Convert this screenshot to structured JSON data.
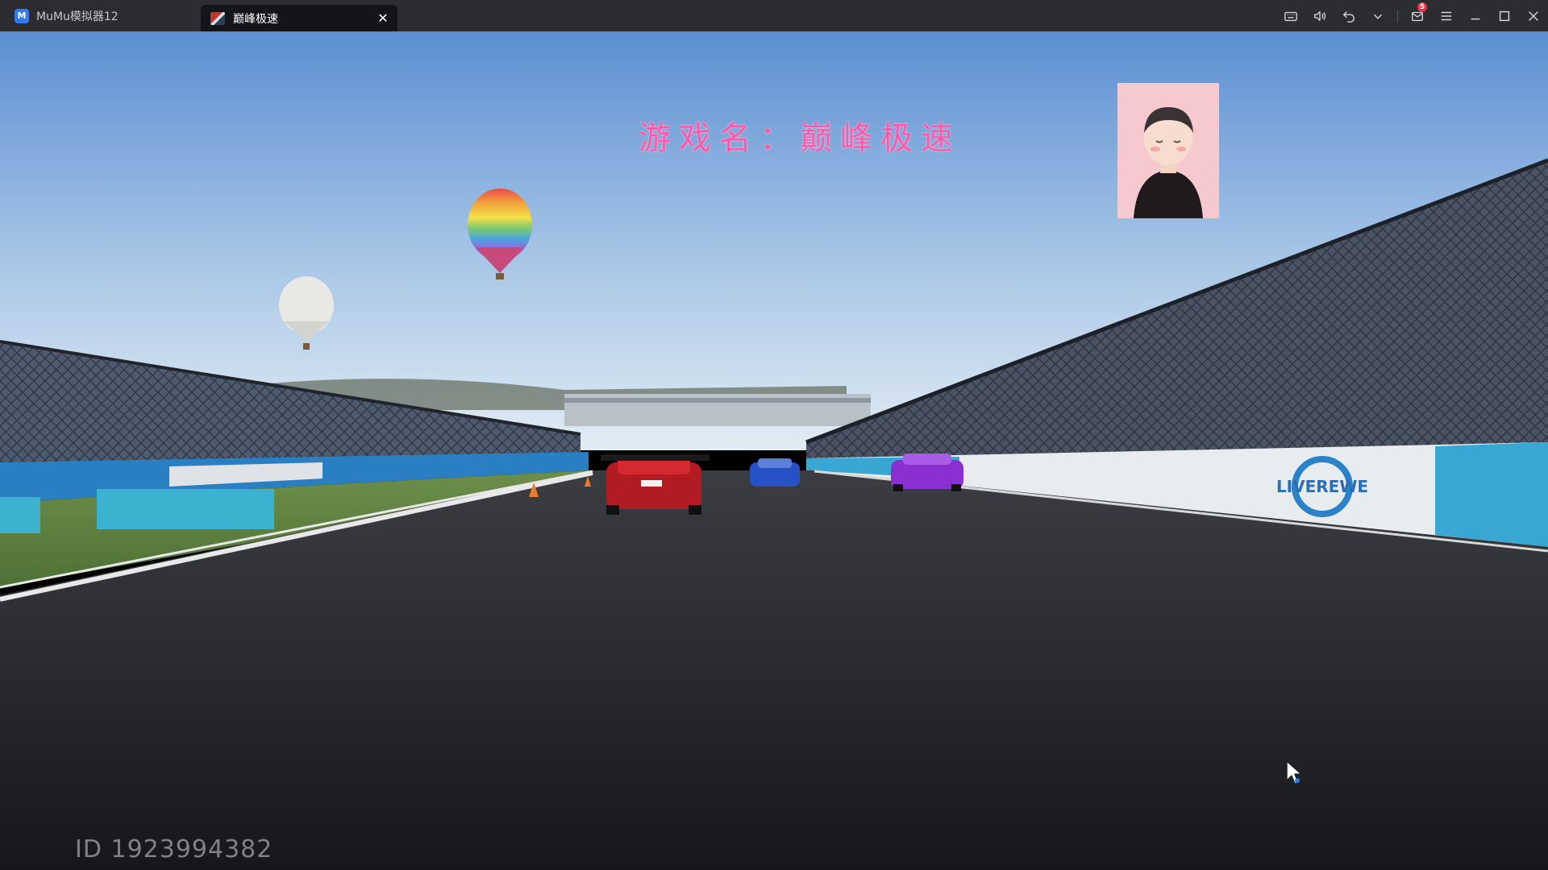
{
  "window": {
    "tabs": [
      {
        "label": "MuMu模拟器12",
        "icon": "mumu-logo-icon",
        "active": false
      },
      {
        "label": "巅峰极速",
        "icon": "game-app-icon",
        "active": true
      }
    ],
    "toolbar_icons": [
      "keyboard-icon",
      "volume-icon",
      "back-icon",
      "chevron-down-icon",
      "mail-icon",
      "menu-icon",
      "minimize-icon",
      "maximize-icon",
      "close-icon"
    ],
    "mail_badge_count": "5",
    "mumu_logo_text": "M"
  },
  "game": {
    "overlay_title": "游戏名：巅峰极速",
    "user_id": "ID 1923994382",
    "banner_text": "LIVEREWE"
  },
  "colors": {
    "titlebar_bg": "#2b2d31",
    "active_tab_bg": "#141518",
    "overlay_title": "#ff5aa9",
    "avatar_bg": "#f6c9cf",
    "badge": "#e8344a"
  }
}
